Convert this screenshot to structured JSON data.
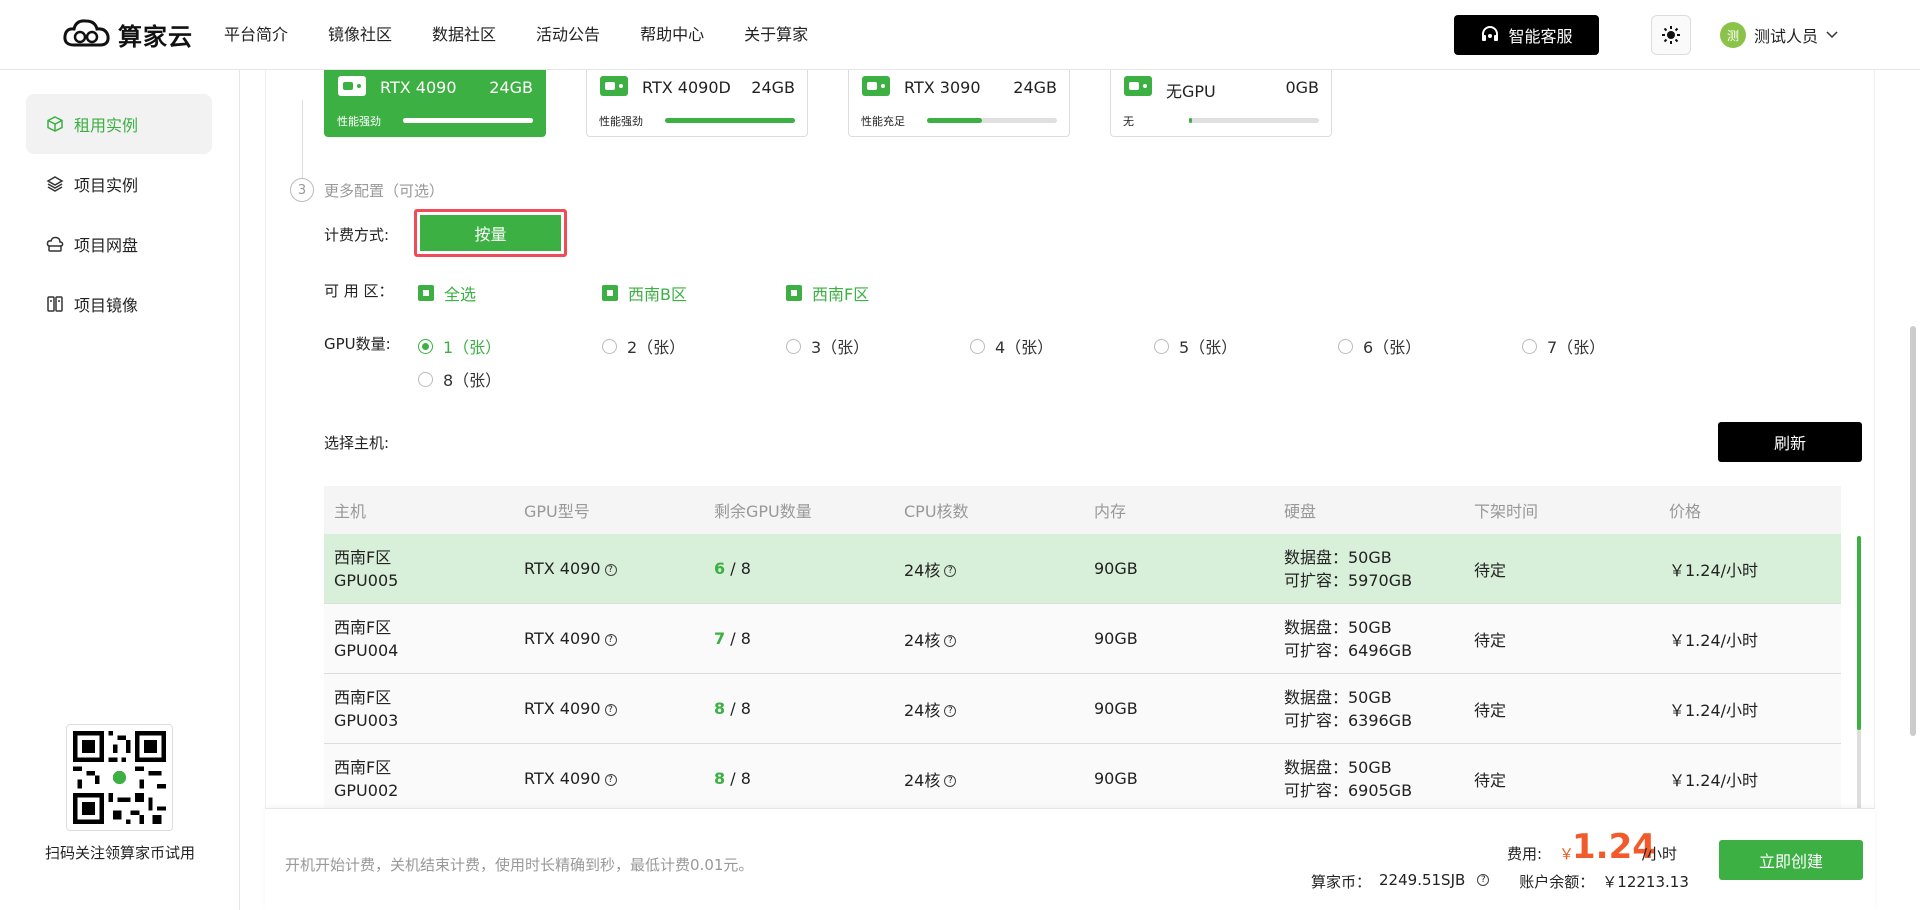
{
  "header": {
    "logo_text": "算家云",
    "nav": [
      "平台简介",
      "镜像社区",
      "数据社区",
      "活动公告",
      "帮助中心",
      "关于算家"
    ],
    "cs_label": "智能客服",
    "user_avatar": "测",
    "user_name": "测试人员"
  },
  "sidebar": {
    "items": [
      {
        "label": "租用实例",
        "icon": "box-icon",
        "active": true
      },
      {
        "label": "项目实例",
        "icon": "layers-icon",
        "active": false
      },
      {
        "label": "项目网盘",
        "icon": "cloud-disk-icon",
        "active": false
      },
      {
        "label": "项目镜像",
        "icon": "image-icon",
        "active": false
      }
    ],
    "qr_caption": "扫码关注领算家币试用"
  },
  "gpu_cards": [
    {
      "name": "RTX 4090",
      "mem": "24GB",
      "perf": "性能强劲",
      "level": 1.0,
      "selected": true
    },
    {
      "name": "RTX 4090D",
      "mem": "24GB",
      "perf": "性能强劲",
      "level": 1.0,
      "selected": false
    },
    {
      "name": "RTX 3090",
      "mem": "24GB",
      "perf": "性能充足",
      "level": 0.42,
      "selected": false
    },
    {
      "name": "无GPU",
      "mem": "0GB",
      "perf": "无",
      "level": 0.02,
      "selected": false
    }
  ],
  "step": {
    "number": "3",
    "label": "更多配置（可选）"
  },
  "billing": {
    "label": "计费方式:",
    "option": "按量"
  },
  "zone": {
    "label": "可 用 区：",
    "options": [
      "全选",
      "西南B区",
      "西南F区"
    ]
  },
  "gpu_count": {
    "label": "GPU数量:",
    "options": [
      "1（张）",
      "2（张）",
      "3（张）",
      "4（张）",
      "5（张）",
      "6（张）",
      "7（张）",
      "8（张）"
    ],
    "selected_index": 0
  },
  "host": {
    "label": "选择主机:",
    "refresh": "刷新"
  },
  "table": {
    "headers": [
      "主机",
      "GPU型号",
      "剩余GPU数量",
      "CPU核数",
      "内存",
      "硬盘",
      "下架时间",
      "价格"
    ],
    "rows": [
      {
        "zone": "西南F区",
        "host": "GPU005",
        "gpu": "RTX 4090",
        "remain": "6",
        "total": " / 8",
        "cpu": "24核",
        "mem": "90GB",
        "disk": "数据盘：50GB",
        "expand": "可扩容：5970GB",
        "offline": "待定",
        "price": "￥1.24/小时"
      },
      {
        "zone": "西南F区",
        "host": "GPU004",
        "gpu": "RTX 4090",
        "remain": "7",
        "total": " / 8",
        "cpu": "24核",
        "mem": "90GB",
        "disk": "数据盘：50GB",
        "expand": "可扩容：6496GB",
        "offline": "待定",
        "price": "￥1.24/小时"
      },
      {
        "zone": "西南F区",
        "host": "GPU003",
        "gpu": "RTX 4090",
        "remain": "8",
        "total": " / 8",
        "cpu": "24核",
        "mem": "90GB",
        "disk": "数据盘：50GB",
        "expand": "可扩容：6396GB",
        "offline": "待定",
        "price": "￥1.24/小时"
      },
      {
        "zone": "西南F区",
        "host": "GPU002",
        "gpu": "RTX 4090",
        "remain": "8",
        "total": " / 8",
        "cpu": "24核",
        "mem": "90GB",
        "disk": "数据盘：50GB",
        "expand": "可扩容：6905GB",
        "offline": "待定",
        "price": "￥1.24/小时"
      }
    ]
  },
  "footer": {
    "note": "开机开始计费，关机结束计费，使用时长精确到秒，最低计费0.01元。",
    "fee_label": "费用:",
    "currency": "￥",
    "fee_value": "1.24",
    "fee_unit": "/小时",
    "coin_label": "算家币：",
    "coin_value": "2249.51SJB",
    "balance_label": "账户余额：",
    "balance_value": "￥12213.13",
    "create": "立即创建"
  },
  "colors": {
    "accent": "#3cb043",
    "price": "#f25a2b",
    "highlight_border": "#f24b58"
  }
}
